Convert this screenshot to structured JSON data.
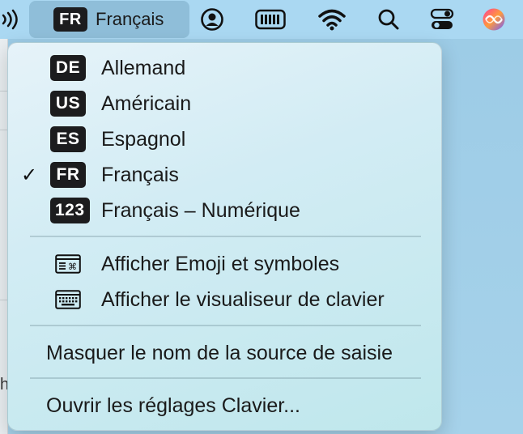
{
  "menubar": {
    "input_source": {
      "code": "FR",
      "label": "Français"
    }
  },
  "menu": {
    "sources": [
      {
        "code": "DE",
        "label": "Allemand",
        "checked": false
      },
      {
        "code": "US",
        "label": "Américain",
        "checked": false
      },
      {
        "code": "ES",
        "label": "Espagnol",
        "checked": false
      },
      {
        "code": "FR",
        "label": "Français",
        "checked": true
      },
      {
        "code": "123",
        "label": "Français – Numérique",
        "checked": false
      }
    ],
    "check_mark": "✓",
    "show_emoji": "Afficher Emoji et symboles",
    "show_keyboard_viewer": "Afficher le visualiseur de clavier",
    "hide_source_name": "Masquer le nom de la source de saisie",
    "open_keyboard_settings": "Ouvrir les réglages Clavier..."
  },
  "background": {
    "partial_text": "h"
  }
}
